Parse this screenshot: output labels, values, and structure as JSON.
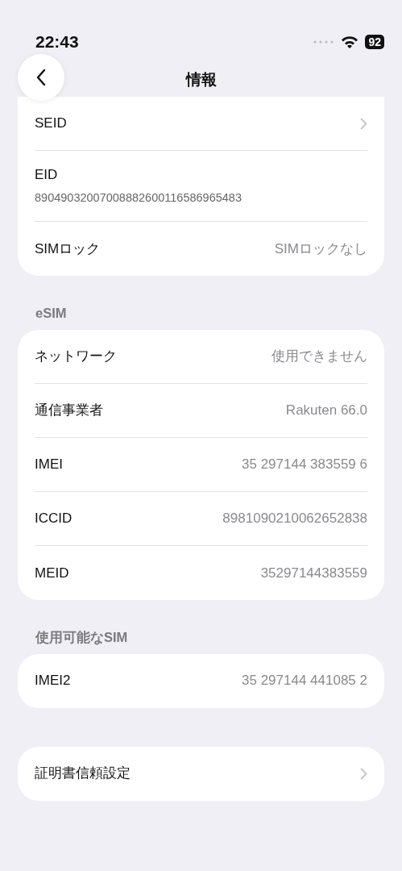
{
  "status_bar": {
    "time": "22:43",
    "battery": "92"
  },
  "nav": {
    "title": "情報"
  },
  "sections": [
    {
      "rows": [
        {
          "kind": "chevron",
          "label": "SEID"
        },
        {
          "kind": "subtitle",
          "label": "EID",
          "value": "89049032007008882600116586965483"
        },
        {
          "kind": "value",
          "label": "SIMロック",
          "value": "SIMロックなし"
        }
      ]
    },
    {
      "header": "eSIM",
      "rows": [
        {
          "kind": "value",
          "label": "ネットワーク",
          "value": "使用できません"
        },
        {
          "kind": "value",
          "label": "通信事業者",
          "value": "Rakuten 66.0"
        },
        {
          "kind": "value",
          "label": "IMEI",
          "value": "35 297144 383559 6"
        },
        {
          "kind": "value",
          "label": "ICCID",
          "value": "8981090210062652838"
        },
        {
          "kind": "value",
          "label": "MEID",
          "value": "35297144383559"
        }
      ]
    },
    {
      "header": "使用可能なSIM",
      "rows": [
        {
          "kind": "value",
          "label": "IMEI2",
          "value": "35 297144 441085 2"
        }
      ]
    },
    {
      "rows": [
        {
          "kind": "chevron",
          "label": "証明書信頼設定"
        }
      ]
    }
  ]
}
